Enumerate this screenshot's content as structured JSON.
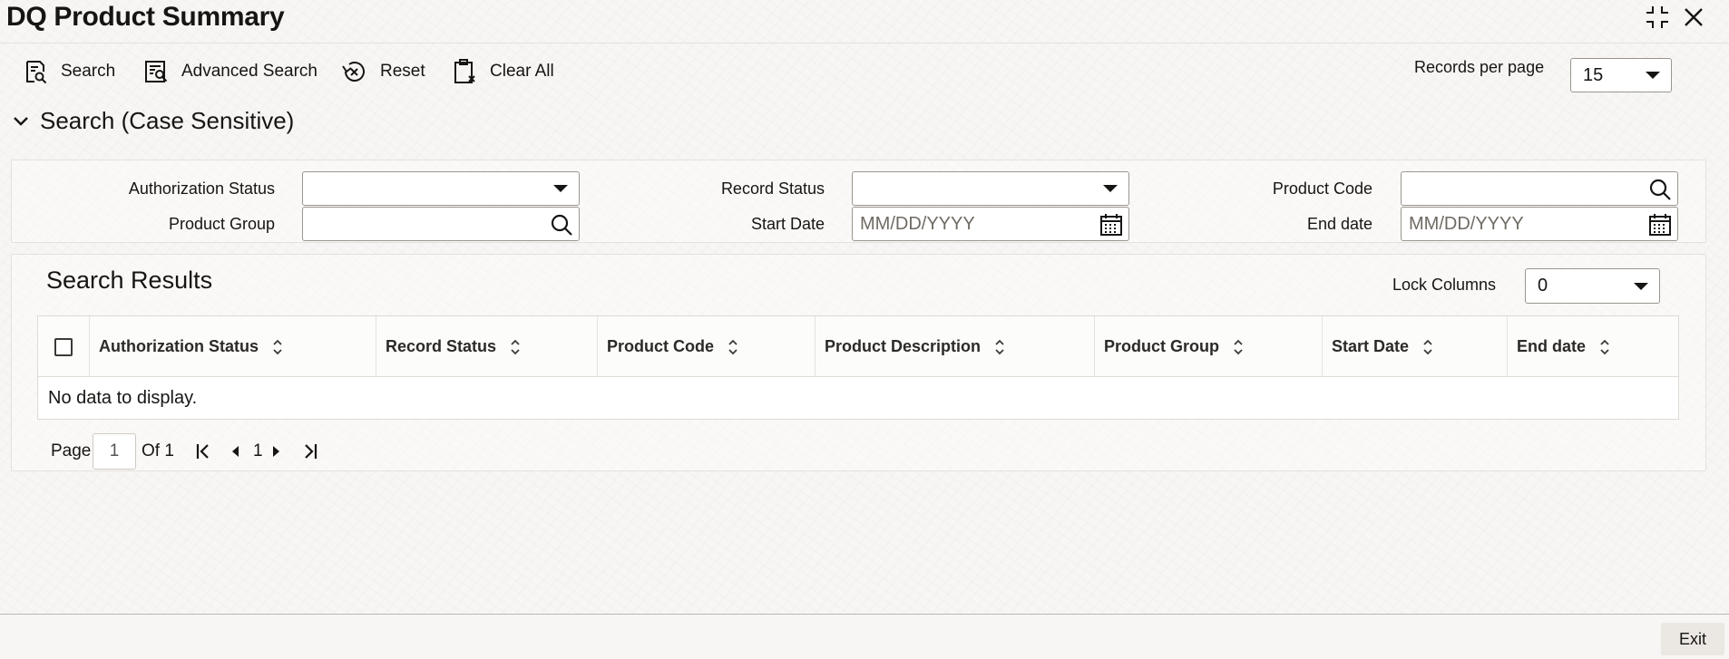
{
  "window": {
    "title": "DQ Product Summary"
  },
  "toolbar": {
    "search_label": "Search",
    "advanced_search_label": "Advanced Search",
    "reset_label": "Reset",
    "clear_all_label": "Clear All",
    "records_per_page_label": "Records per page",
    "records_per_page_value": "15"
  },
  "search_section": {
    "title": "Search (Case Sensitive)",
    "fields": {
      "authorization_status": {
        "label": "Authorization Status",
        "value": ""
      },
      "record_status": {
        "label": "Record Status",
        "value": ""
      },
      "product_code": {
        "label": "Product Code",
        "value": ""
      },
      "product_group": {
        "label": "Product Group",
        "value": ""
      },
      "start_date": {
        "label": "Start Date",
        "placeholder": "MM/DD/YYYY"
      },
      "end_date": {
        "label": "End date",
        "placeholder": "MM/DD/YYYY"
      }
    }
  },
  "results": {
    "title": "Search Results",
    "lock_columns_label": "Lock Columns",
    "lock_columns_value": "0",
    "columns": [
      "Authorization Status",
      "Record Status",
      "Product Code",
      "Product Description",
      "Product Group",
      "Start Date",
      "End date"
    ],
    "empty_message": "No data to display.",
    "pagination": {
      "page_label": "Page",
      "current_page": "1",
      "of_label": "Of 1",
      "page_number": "1"
    }
  },
  "footer": {
    "exit_label": "Exit"
  },
  "colors": {
    "background": "#f7f6f4",
    "text": "#161513",
    "border": "#9a968e",
    "exit_button": "#ebe8e4"
  }
}
